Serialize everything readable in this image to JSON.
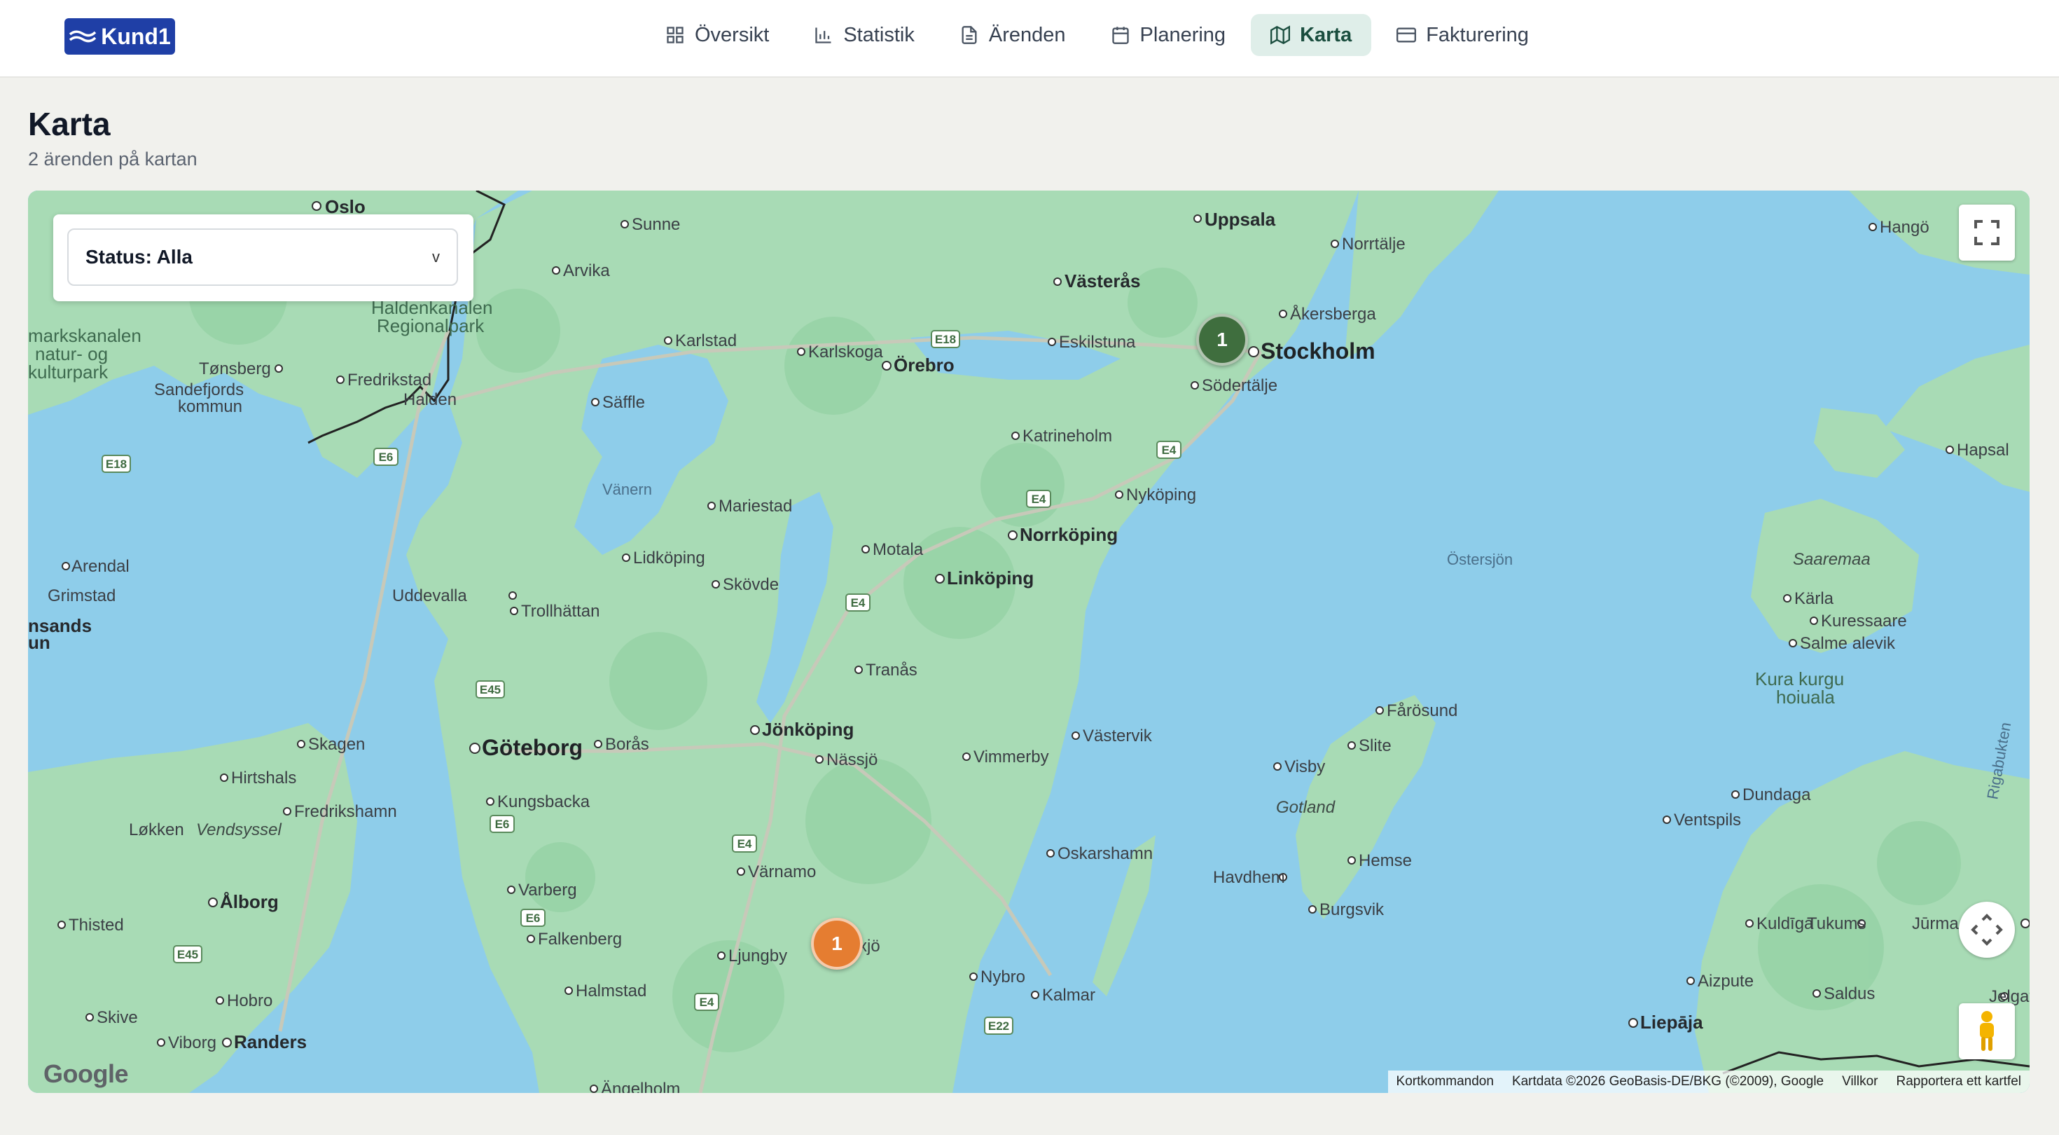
{
  "app": {
    "logo_text": "Kund1"
  },
  "nav": {
    "tabs": [
      {
        "label": "Översikt",
        "icon": "grid-icon"
      },
      {
        "label": "Statistik",
        "icon": "bar-chart-icon"
      },
      {
        "label": "Ärenden",
        "icon": "document-icon"
      },
      {
        "label": "Planering",
        "icon": "calendar-icon"
      },
      {
        "label": "Karta",
        "icon": "map-icon",
        "active": true
      },
      {
        "label": "Fakturering",
        "icon": "credit-card-icon"
      }
    ]
  },
  "page": {
    "title": "Karta",
    "subtitle": "2 ärenden på kartan"
  },
  "map": {
    "status_filter": {
      "label": "Status: Alla",
      "caret": "v"
    },
    "markers": [
      {
        "count": "1",
        "color": "#3f6e3e",
        "near": "Stockholm"
      },
      {
        "count": "1",
        "color": "#e57d31",
        "near": "Växjö"
      }
    ],
    "google": "Google",
    "attribution": {
      "shortcuts": "Kortkommandon",
      "data": "Kartdata ©2026 GeoBasis-DE/BKG (©2009), Google",
      "terms": "Villkor",
      "report": "Rapportera ett kartfel"
    },
    "labels": {
      "oslo": "Oslo",
      "sunne": "Sunne",
      "uppsala": "Uppsala",
      "norrtalje": "Norrtälje",
      "hango": "Hangö",
      "arvika": "Arvika",
      "vasteras": "Västerås",
      "akersberga": "Åkersberga",
      "haldenkanalen": "Haldenkanalen",
      "regionalpark": "Regionalpark",
      "markskanalen": "markskanalen",
      "natur_og": "natur- og",
      "kulturpark": "kulturpark",
      "karlstad": "Karlstad",
      "karlskoga": "Karlskoga",
      "orebro": "Örebro",
      "eskilstuna": "Eskilstuna",
      "stockholm": "Stockholm",
      "sodertalje": "Södertälje",
      "tonsberg": "Tønsberg",
      "fredrikstad": "Fredrikstad",
      "sandefjords": "Sandefjords",
      "kommun": "kommun",
      "halden": "Halden",
      "saffle": "Säffle",
      "katrineholm": "Katrineholm",
      "hapsal": "Hapsal",
      "vanern": "Vänern",
      "mariestad": "Mariestad",
      "nykoping": "Nyköping",
      "norrkoping": "Norrköping",
      "motala": "Motala",
      "lidkoping": "Lidköping",
      "ostersjon": "Östersjön",
      "arendal": "Arendal",
      "saaremaa": "Saaremaa",
      "skovde": "Skövde",
      "linkoping": "Linköping",
      "grimstad": "Grimstad",
      "uddevalla": "Uddevalla",
      "trollhattan": "Trollhättan",
      "karla": "Kärla",
      "kuressaare": "Kuressaare",
      "insands": "nsands",
      "un": "un",
      "salme": "Salme alevik",
      "tranas": "Tranås",
      "kura_kurgu": "Kura kurgu",
      "hoiuala": "hoiuala",
      "farosund": "Fårösund",
      "jonkoping": "Jönköping",
      "vastervik": "Västervik",
      "skagen": "Skagen",
      "goteborg": "Göteborg",
      "boras": "Borås",
      "slite": "Slite",
      "rigabukten": "Rigabukten",
      "nassjo": "Nässjö",
      "vimmerby": "Vimmerby",
      "visby": "Visby",
      "hirtshals": "Hirtshals",
      "dundaga": "Dundaga",
      "gotland": "Gotland",
      "kungsbacka": "Kungsbacka",
      "fredrikshamn": "Fredrikshamn",
      "ventspils": "Ventspils",
      "lokken": "Løkken",
      "vendsyssel": "Vendsyssel",
      "oskarshamn": "Oskarshamn",
      "hemse": "Hemse",
      "varnamo": "Värnamo",
      "havdhem": "Havdhem",
      "varberg": "Varberg",
      "alborg": "Ålborg",
      "burgsvik": "Burgsvik",
      "kuldiga": "Kuldīga",
      "tukums": "Tukums",
      "jurma": "Jūrma",
      "thisted": "Thisted",
      "falkenberg": "Falkenberg",
      "vaxjo": "xjö",
      "ljungby": "Ljungby",
      "nybro": "Nybro",
      "aizpute": "Aizpute",
      "halmstad": "Halmstad",
      "kalmar": "Kalmar",
      "hobro": "Hobro",
      "saldus": "Saldus",
      "jelgava": "Jelgav",
      "skive": "Skive",
      "liepaja": "Liepāja",
      "viborg": "Viborg",
      "randers": "Randers",
      "angelholm": "Ängelholm"
    },
    "roads": [
      "E18",
      "E18",
      "E6",
      "E4",
      "E4",
      "E4",
      "E45",
      "E6",
      "E4",
      "E6",
      "E45",
      "E4",
      "E22"
    ]
  }
}
